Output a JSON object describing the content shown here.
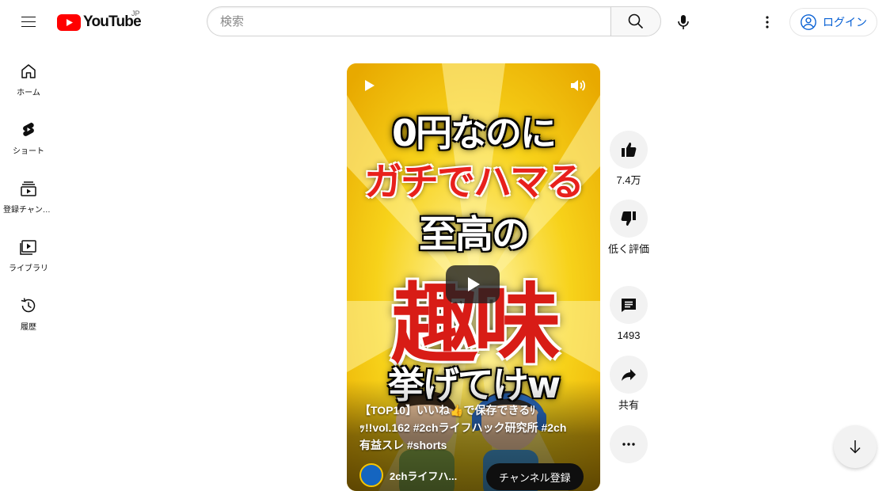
{
  "header": {
    "logo_text": "YouTube",
    "country_code": "JP",
    "search_placeholder": "検索",
    "login_label": "ログイン",
    "icons": {
      "menu": "menu-icon",
      "search": "search-icon",
      "mic": "mic-icon",
      "more": "more-vert-icon",
      "account": "account-circle-icon"
    }
  },
  "sidebar": {
    "items": [
      {
        "label": "ホーム",
        "icon": "home-icon"
      },
      {
        "label": "ショート",
        "icon": "shorts-icon"
      },
      {
        "label": "登録チャンネル",
        "icon": "subscriptions-icon"
      },
      {
        "label": "ライブラリ",
        "icon": "library-icon"
      },
      {
        "label": "履歴",
        "icon": "history-icon"
      }
    ]
  },
  "video": {
    "thumbnail_text": [
      "0円なのに",
      "ガチでハマる",
      "至高の",
      "趣味",
      "挙げてけw"
    ],
    "caption": "【TOP10】いいね👍で保存できるﾘｯ!!vol.162 #2chライフハック研究所 #2ch有益スレ #shorts",
    "channel_name": "2chライフハ...",
    "subscribe_label": "チャンネル登録"
  },
  "actions": {
    "like_count": "7.4万",
    "dislike_label": "低く評価",
    "comment_count": "1493",
    "share_label": "共有",
    "more_label": "…"
  },
  "colors": {
    "brand_red": "#ff0000",
    "link_blue": "#065fd4",
    "thumbnail_yellow": "#f5c400",
    "thumbnail_red": "#e8201c"
  }
}
